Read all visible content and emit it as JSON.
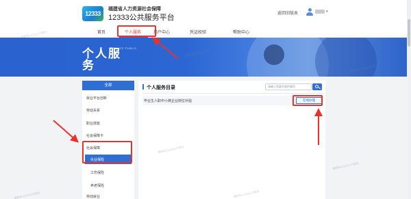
{
  "header": {
    "logo_text": "12333",
    "org_name": "福建省人力资源社会保障",
    "platform_name": "12333公共服务平台",
    "back_link": "返回旧版本",
    "user_caret": "▾"
  },
  "nav": {
    "items": [
      {
        "label": "首页"
      },
      {
        "label": "个人服务"
      },
      {
        "label": "用户中心"
      },
      {
        "label": "凭证校验"
      },
      {
        "label": "帮助中心"
      }
    ],
    "active_index": 1
  },
  "banner": {
    "title": "个人服务",
    "subtitle": "SERVICE PUBLIC"
  },
  "sidebar": {
    "header": "全部",
    "items": [
      {
        "label": "就业平台创新"
      },
      {
        "label": "劳动关系"
      },
      {
        "label": "职业技能"
      },
      {
        "label": "社会保障卡"
      },
      {
        "label": "社会保障"
      },
      {
        "label": "失业保险"
      },
      {
        "label": "工伤保险"
      },
      {
        "label": "养老保险"
      },
      {
        "label": "劳动就业"
      }
    ],
    "active_label": "失业保险"
  },
  "main": {
    "title": "个人服务目录",
    "search_placeholder": "请输入您要办理的事项",
    "service_name": "毕业生人职中小微企业岗位补贴",
    "apply_label": "在线办理"
  },
  "watermark_text": "福建省12333公共服务",
  "colors": {
    "primary": "#2f6ed3",
    "highlight": "#e8322a",
    "active_nav": "#e63d2e"
  }
}
